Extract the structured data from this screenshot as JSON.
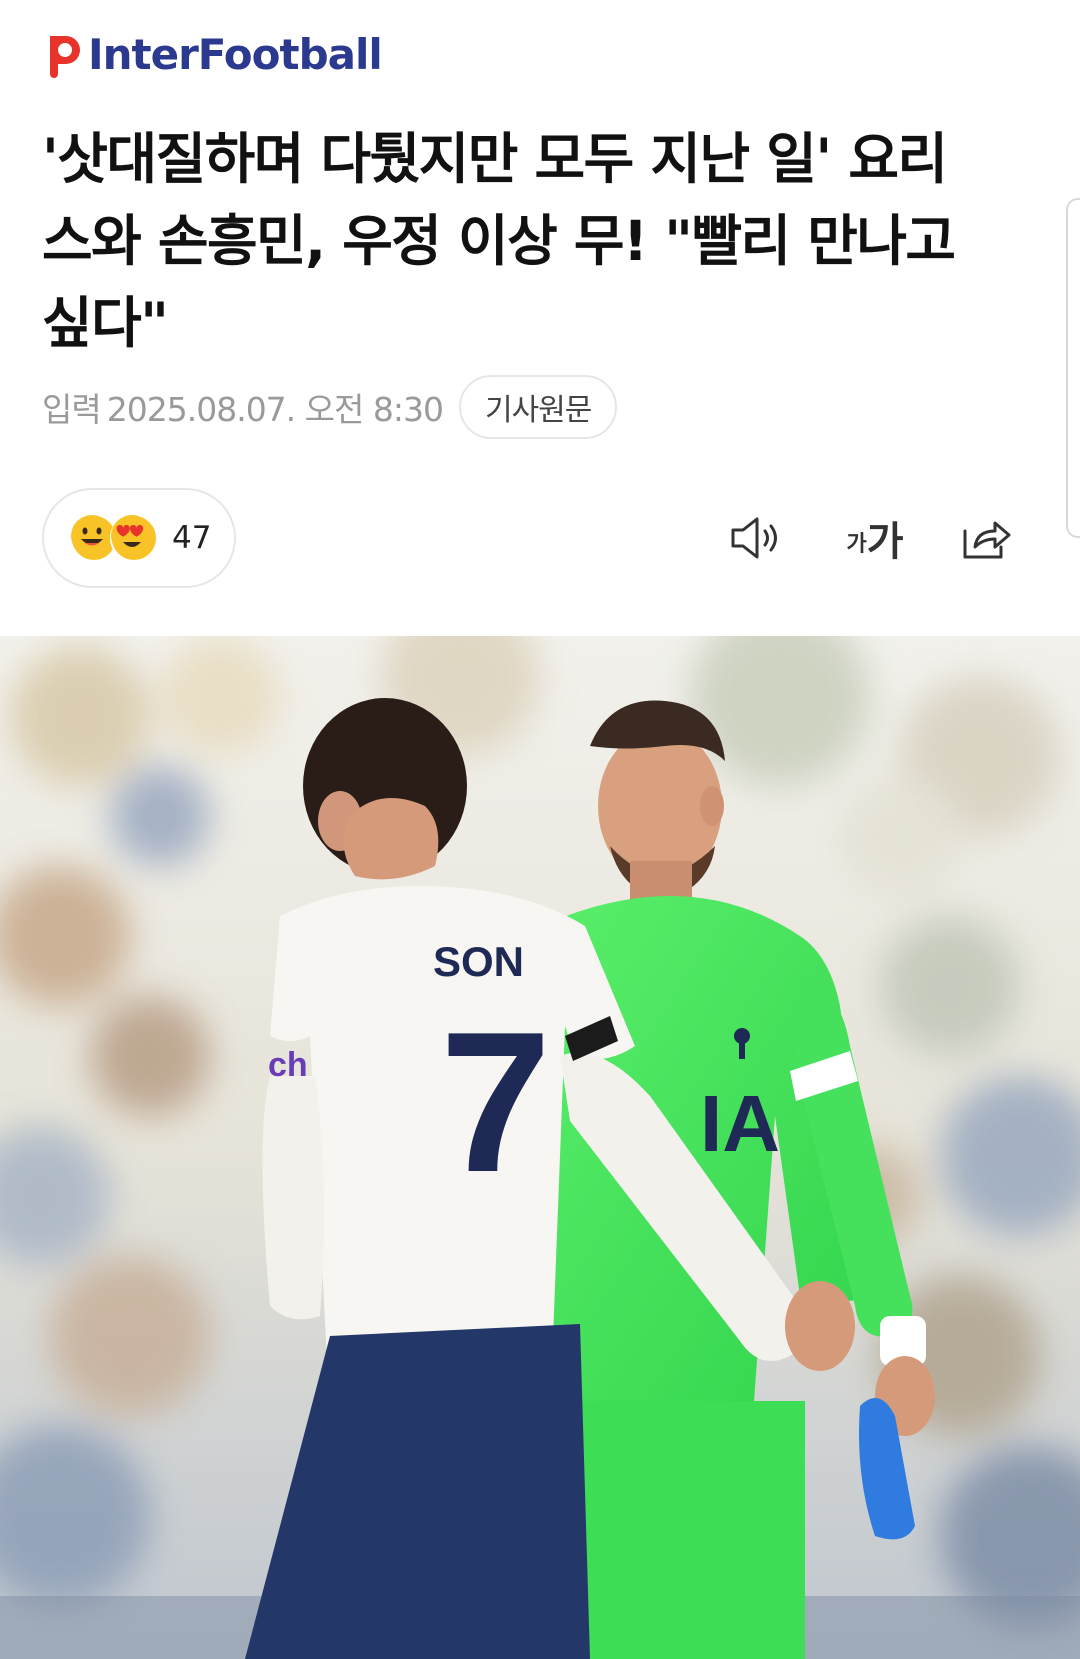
{
  "brand": {
    "name": "InterFootball",
    "logo_color": "#e8332a",
    "text_color": "#2b3a8f"
  },
  "article": {
    "headline_lines": [
      "'삿대질하며 다퉜지만 모두 지난 일' 요리",
      "스와 손흥민, 우정 이상 무! \"빨리 만나고",
      "싶다\""
    ],
    "published_label": "입력",
    "published_date": "2025.08.07. 오전 8:30",
    "source_button": "기사원문"
  },
  "reactions": {
    "emojis": [
      "smile-emoji-icon",
      "heart-eyes-emoji-icon"
    ],
    "count": "47"
  },
  "toolbar": {
    "tts_icon": "speaker-icon",
    "font_small": "가",
    "font_big": "가",
    "share_icon": "share-icon"
  },
  "photo": {
    "jersey_name": "SON",
    "jersey_number": "7",
    "sponsor_left": "ch",
    "sponsor_center": "IA"
  }
}
